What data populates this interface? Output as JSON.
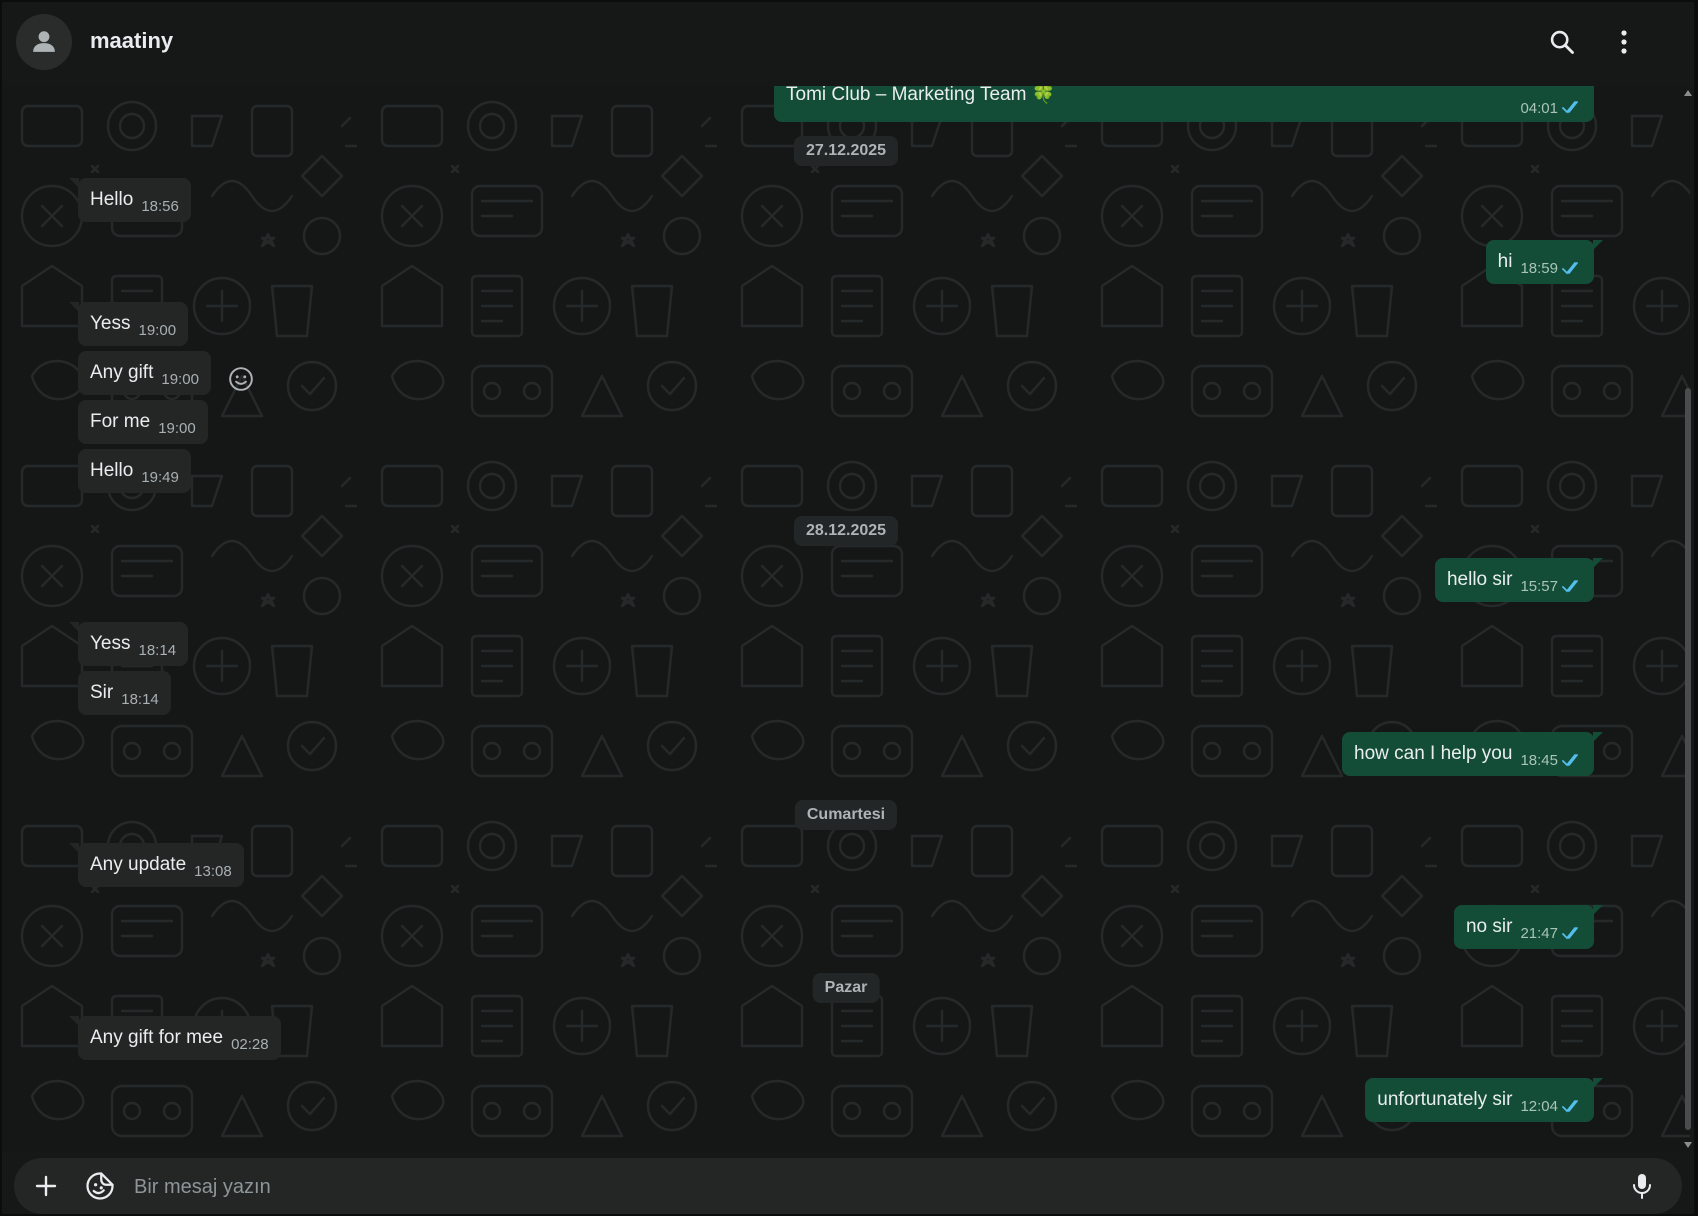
{
  "header": {
    "contact_name": "maatiny",
    "avatar_icon": "person-icon",
    "actions": [
      "search-icon",
      "more-vertical-icon"
    ]
  },
  "messages": [
    {
      "id": "m0",
      "dir": "out",
      "text": "Tomi Club – Marketing Team 🍀",
      "time": "04:01",
      "status": "read"
    },
    {
      "id": "d1",
      "type": "date",
      "text": "27.12.2025"
    },
    {
      "id": "m1",
      "dir": "in",
      "text": "Hello",
      "time": "18:56"
    },
    {
      "id": "m2",
      "dir": "out",
      "text": "hi",
      "time": "18:59",
      "status": "read"
    },
    {
      "id": "m3",
      "dir": "in",
      "text": "Yess",
      "time": "19:00"
    },
    {
      "id": "m4",
      "dir": "in",
      "text": "Any gift",
      "time": "19:00"
    },
    {
      "id": "m5",
      "dir": "in",
      "text": "For me",
      "time": "19:00"
    },
    {
      "id": "m6",
      "dir": "in",
      "text": "Hello",
      "time": "19:49"
    },
    {
      "id": "d2",
      "type": "date",
      "text": "28.12.2025"
    },
    {
      "id": "m7",
      "dir": "out",
      "text": "hello sir",
      "time": "15:57",
      "status": "read"
    },
    {
      "id": "m8",
      "dir": "in",
      "text": "Yess",
      "time": "18:14"
    },
    {
      "id": "m9",
      "dir": "in",
      "text": "Sir",
      "time": "18:14"
    },
    {
      "id": "m10",
      "dir": "out",
      "text": "how can I help you",
      "time": "18:45",
      "status": "read"
    },
    {
      "id": "d3",
      "type": "date",
      "text": "Cumartesi"
    },
    {
      "id": "m11",
      "dir": "in",
      "text": "Any update",
      "time": "13:08"
    },
    {
      "id": "m12",
      "dir": "out",
      "text": "no sir",
      "time": "21:47",
      "status": "read"
    },
    {
      "id": "d4",
      "type": "date",
      "text": "Pazar"
    },
    {
      "id": "m13",
      "dir": "in",
      "text": "Any gift for mee",
      "time": "02:28"
    },
    {
      "id": "m14",
      "dir": "out",
      "text": "unfortunately sir",
      "time": "12:04",
      "status": "read"
    }
  ],
  "composer": {
    "placeholder": "Bir mesaj yazın",
    "attach_icon": "plus-icon",
    "sticker_icon": "sticker-icon",
    "mic_icon": "microphone-icon"
  },
  "colors": {
    "incoming_bubble": "#242626",
    "outgoing_bubble": "#144d37",
    "read_ticks": "#53bdeb",
    "chat_background": "#151717"
  }
}
